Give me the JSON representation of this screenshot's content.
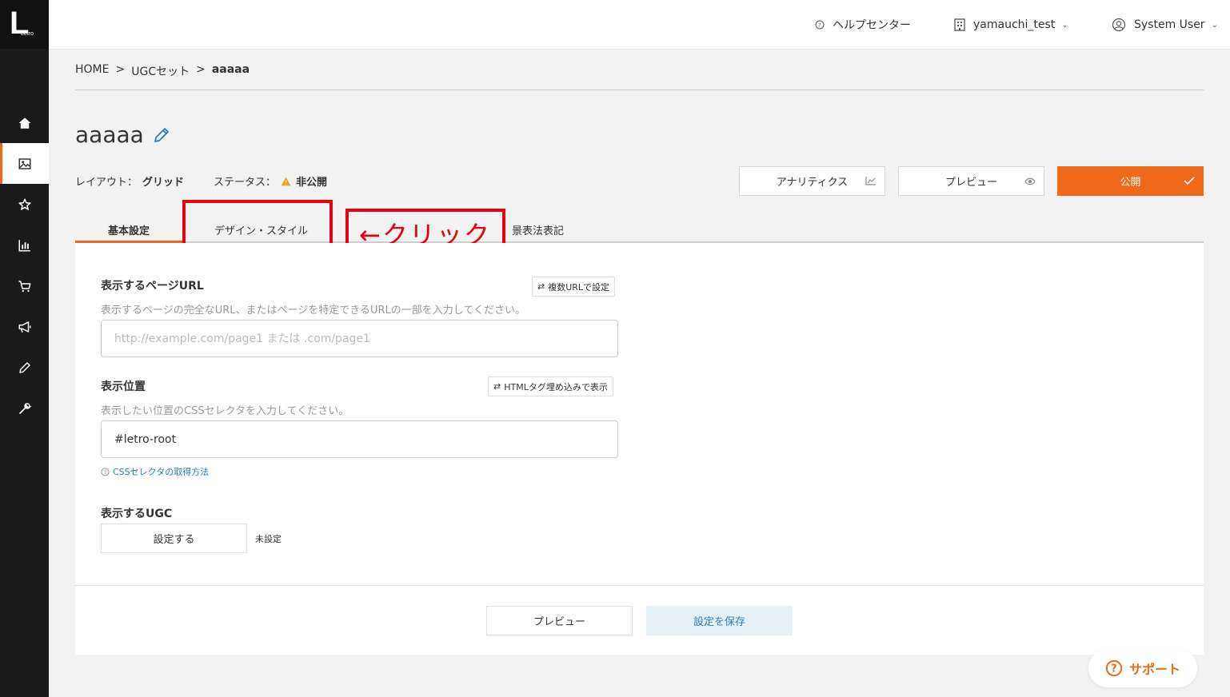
{
  "brand": {
    "logo_letter": "L",
    "logo_text": "Letro",
    "accent_color": "#ee6a1a",
    "sidebar_bg": "#1a1a1a"
  },
  "sidebar": {
    "items": [
      {
        "icon": "home-icon",
        "active": false
      },
      {
        "icon": "image-icon",
        "active": true
      },
      {
        "icon": "star-icon",
        "active": false
      },
      {
        "icon": "bar-chart-icon",
        "active": false
      },
      {
        "icon": "cart-icon",
        "active": false
      },
      {
        "icon": "megaphone-icon",
        "active": false
      },
      {
        "icon": "pencil-icon",
        "active": false
      },
      {
        "icon": "wrench-icon",
        "active": false
      }
    ]
  },
  "header": {
    "help_center": "ヘルプセンター",
    "account": "yamauchi_test",
    "user": "System User"
  },
  "breadcrumb": {
    "home": "HOME",
    "sep": ">",
    "ugc_set": "UGCセット",
    "current": "aaaaa"
  },
  "page": {
    "title": "aaaaa",
    "layout_label": "レイアウト：",
    "layout_value": "グリッド",
    "status_label": "ステータス：",
    "status_value": "非公開"
  },
  "actions": {
    "analytics": "アナリティクス",
    "preview": "プレビュー",
    "publish": "公開"
  },
  "tabs": [
    {
      "label": "基本設定",
      "active": true
    },
    {
      "label": "デザイン・スタイル",
      "active": false
    },
    {
      "label": "景表法表記",
      "active": false
    }
  ],
  "annotation": {
    "click_text": "←クリック",
    "color": "#e60012"
  },
  "form": {
    "url": {
      "label": "表示するページURL",
      "desc": "表示するページの完全なURL、またはページを特定できるURLの一部を入力してください。",
      "placeholder": "http://example.com/page1 または .com/page1",
      "value": "",
      "toggle": "複数URLで設定"
    },
    "position": {
      "label": "表示位置",
      "desc": "表示したい位置のCSSセレクタを入力してください。",
      "value": "#letro-root",
      "toggle": "HTMLタグ埋め込みで表示",
      "help": "CSSセレクタの取得方法"
    },
    "ugc": {
      "label": "表示するUGC",
      "button": "設定する",
      "status": "未設定"
    }
  },
  "footer_actions": {
    "preview": "プレビュー",
    "save": "設定を保存"
  },
  "support": {
    "label": "サポート"
  }
}
